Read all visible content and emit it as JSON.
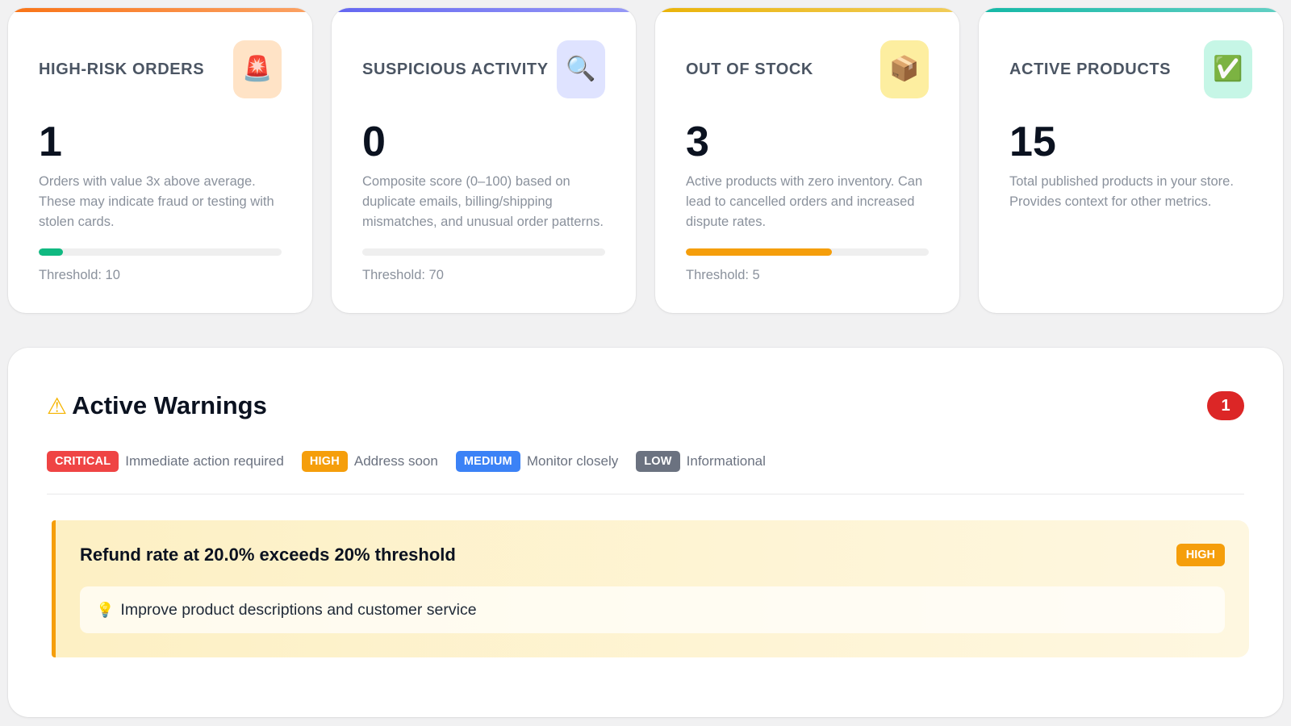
{
  "cards": [
    {
      "title": "HIGH-RISK ORDERS",
      "icon": "siren-icon",
      "icon_glyph": "🚨",
      "icon_bg": "#ffe3c6",
      "accent": "#f97316",
      "value": "1",
      "description": "Orders with value 3x above average. These may indicate fraud or testing with stolen cards.",
      "progress": 0.1,
      "progress_color": "#10b981",
      "threshold": "Threshold: 10"
    },
    {
      "title": "SUSPICIOUS ACTIVITY",
      "icon": "magnifier-icon",
      "icon_glyph": "🔍",
      "icon_bg": "#dfe3ff",
      "accent": "#6366f1",
      "value": "0",
      "description": "Composite score (0–100) based on duplicate emails, billing/shipping mismatches, and unusual order patterns.",
      "progress": 0,
      "progress_color": "#10b981",
      "threshold": "Threshold: 70"
    },
    {
      "title": "OUT OF STOCK",
      "icon": "package-icon",
      "icon_glyph": "📦",
      "icon_bg": "#fdeea0",
      "accent": "#eab308",
      "value": "3",
      "description": "Active products with zero inventory. Can lead to cancelled orders and increased dispute rates.",
      "progress": 0.6,
      "progress_color": "#f59e0b",
      "threshold": "Threshold: 5"
    },
    {
      "title": "ACTIVE PRODUCTS",
      "icon": "check-box-icon",
      "icon_glyph": "✅",
      "icon_bg": "#c6f6e6",
      "accent": "#14b8a6",
      "value": "15",
      "description": "Total published products in your store. Provides context for other metrics."
    }
  ],
  "warnings": {
    "icon": "warning-icon",
    "icon_glyph": "⚠",
    "title": "Active Warnings",
    "count": "1",
    "legend": [
      {
        "badge": "CRITICAL",
        "color": "#ef4444",
        "text": "Immediate action required"
      },
      {
        "badge": "HIGH",
        "color": "#f59e0b",
        "text": "Address soon"
      },
      {
        "badge": "MEDIUM",
        "color": "#3b82f6",
        "text": "Monitor closely"
      },
      {
        "badge": "LOW",
        "color": "#6b7280",
        "text": "Informational"
      }
    ],
    "alert": {
      "title": "Refund rate at 20.0% exceeds 20% threshold",
      "severity": "HIGH",
      "recommendation_icon": "lightbulb-icon",
      "recommendation_glyph": "💡",
      "recommendation": "Improve product descriptions and customer service"
    }
  }
}
